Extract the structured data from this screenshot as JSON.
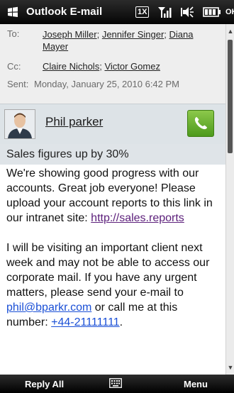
{
  "titlebar": {
    "title": "Outlook E-mail",
    "icons": [
      "windows-flag-icon",
      "network-1x-icon",
      "signal-icon",
      "volume-icon",
      "battery-icon"
    ],
    "network_label": "1X",
    "ok_label": "OK"
  },
  "header": {
    "to_label": "To:",
    "to_recipients": [
      "Joseph Miller",
      "Jennifer Singer",
      "Diana Mayer"
    ],
    "cc_label": "Cc:",
    "cc_recipients": [
      "Claire Nichols",
      "Victor Gomez"
    ],
    "sent_label": "Sent:",
    "sent_value": "Monday, January 25, 2010 6:42 PM"
  },
  "contact": {
    "sender_name": "Phil parker",
    "call_icon": "phone-icon"
  },
  "message": {
    "subject": "Sales figures up by 30%",
    "para1_text": "We're showing good progress with our accounts. Great job everyone! Please upload your account reports to this link in our intranet site: ",
    "para1_link": "http://sales.reports",
    "para2_text": "I will be visiting an important client next week and may not be able to access our corporate mail. If you have any urgent matters, please send your e-mail to ",
    "email_link": "phil@bparkr.com",
    "para2_mid": " or call me at this number: ",
    "phone_link": "+44-21111111",
    "para2_end": "."
  },
  "softkeys": {
    "left": "Reply All",
    "middle_icon": "keyboard-icon",
    "right": "Menu"
  },
  "colors": {
    "header_bg": "#eeeeee",
    "contact_bg": "#dde3e7",
    "call_green": "#5aa928",
    "visited_link": "#5b1e7a",
    "link_blue": "#1a4fd6"
  }
}
